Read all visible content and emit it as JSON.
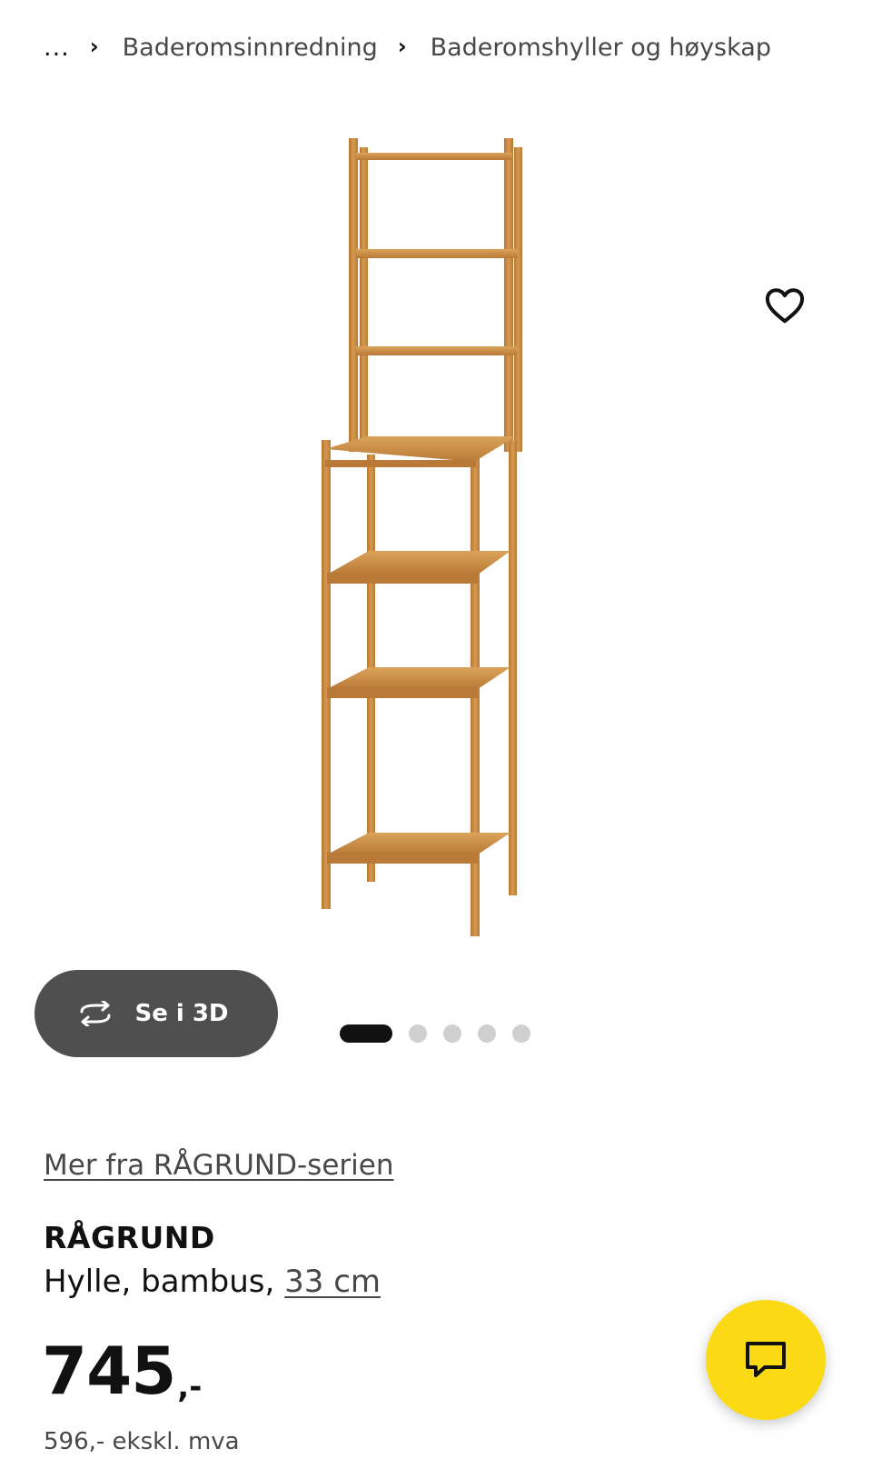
{
  "breadcrumb": {
    "ellipsis": "...",
    "items": [
      "Baderomsinnredning",
      "Baderomshyller og høyskap"
    ]
  },
  "gallery": {
    "image_alt": "RÅGRUND shelf unit",
    "view3d_label": "Se i 3D",
    "dots_total": 5,
    "active_dot": 1
  },
  "product": {
    "series_link": "Mer fra RÅGRUND-serien",
    "name": "RÅGRUND",
    "description": "Hylle, bambus, ",
    "size_link": "33 cm",
    "price": "745",
    "price_suffix": ",-",
    "price_excl": "596,- ekskl. mva"
  },
  "colors": {
    "accent_yellow": "#fbd914",
    "button_dark": "#4f4f4f",
    "bamboo": "#c98a3e"
  },
  "icons": {
    "favorite": "heart-outline-icon",
    "rotate_3d": "rotate-arrows-icon",
    "chat": "chat-bubble-icon"
  }
}
